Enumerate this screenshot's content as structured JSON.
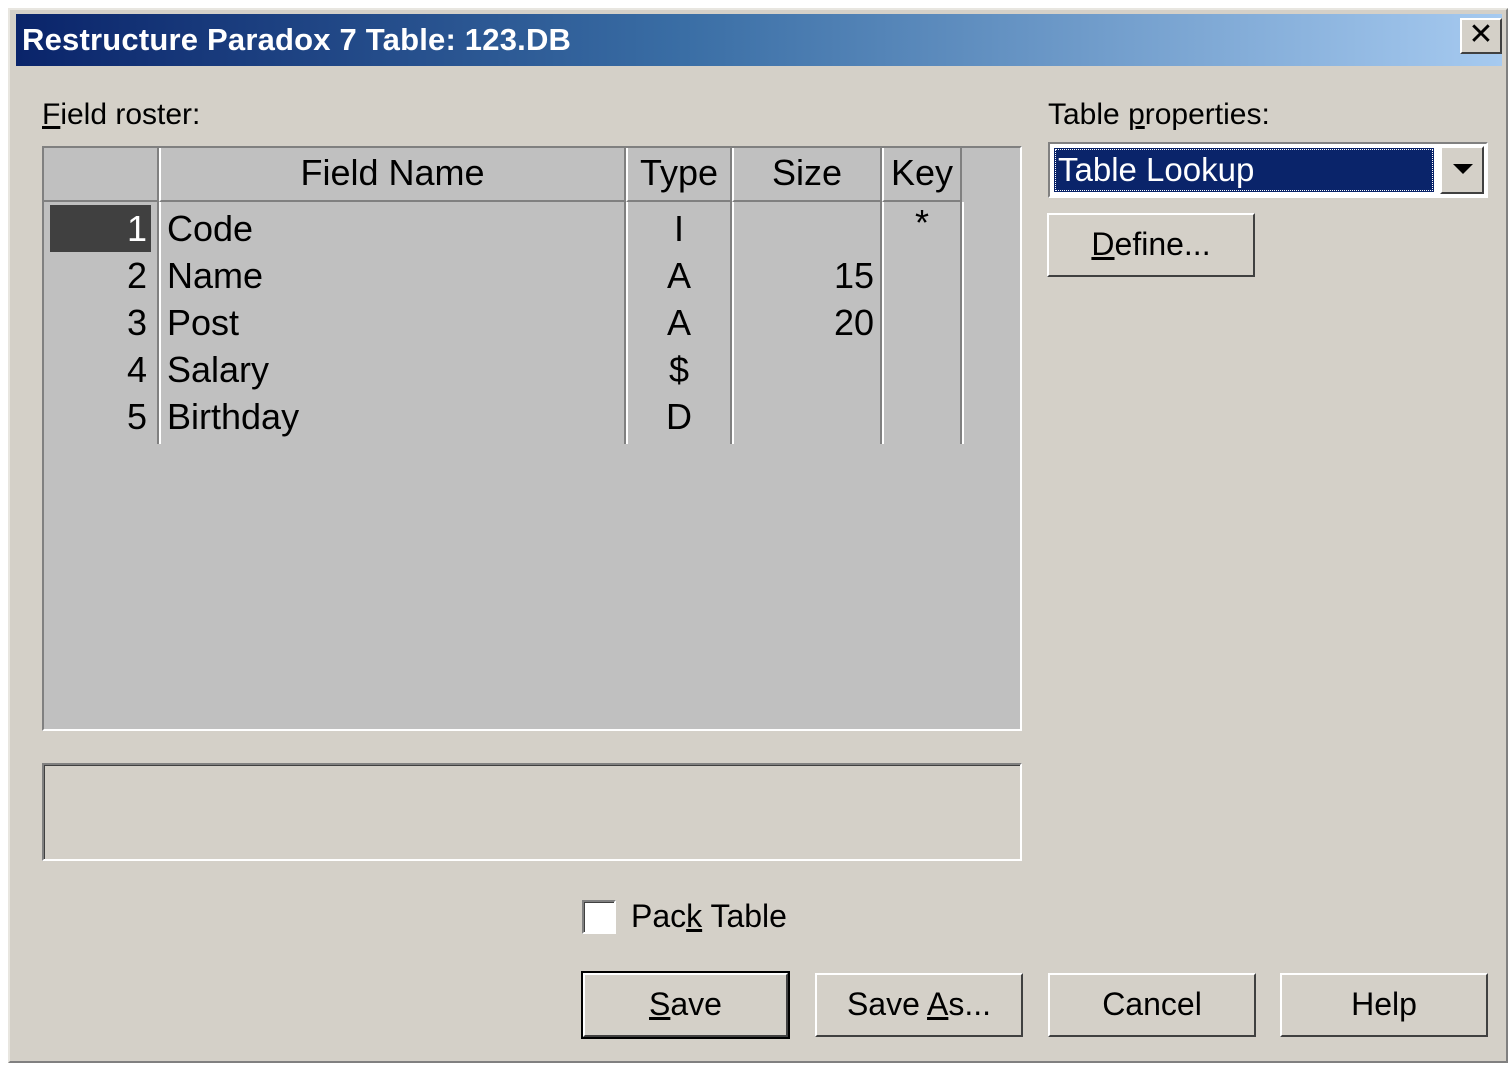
{
  "window": {
    "title": "Restructure Paradox 7 Table: 123.DB",
    "close_label": "✕"
  },
  "field_roster": {
    "label_first": "F",
    "label_rest": "ield roster:",
    "columns": [
      "Field Name",
      "Type",
      "Size",
      "Key"
    ],
    "rows": [
      {
        "num": "1",
        "name": "Code",
        "type": "I",
        "size": "",
        "key": "*",
        "selected": true
      },
      {
        "num": "2",
        "name": "Name",
        "type": "A",
        "size": "15",
        "key": "",
        "selected": false
      },
      {
        "num": "3",
        "name": "Post",
        "type": "A",
        "size": "20",
        "key": "",
        "selected": false
      },
      {
        "num": "4",
        "name": "Salary",
        "type": "$",
        "size": "",
        "key": "",
        "selected": false
      },
      {
        "num": "5",
        "name": "Birthday",
        "type": "D",
        "size": "",
        "key": "",
        "selected": false
      }
    ]
  },
  "table_properties": {
    "label_pre": "Table ",
    "label_u": "p",
    "label_post": "roperties:",
    "selected": "Table Lookup",
    "define_u": "D",
    "define_rest": "efine..."
  },
  "pack_table": {
    "label_pre": "Pac",
    "label_u": "k",
    "label_post": " Table",
    "checked": false
  },
  "buttons": {
    "save_u": "S",
    "save_rest": "ave",
    "save_as_pre": "Save ",
    "save_as_u": "A",
    "save_as_post": "s...",
    "cancel": "Cancel",
    "help": "Help"
  }
}
